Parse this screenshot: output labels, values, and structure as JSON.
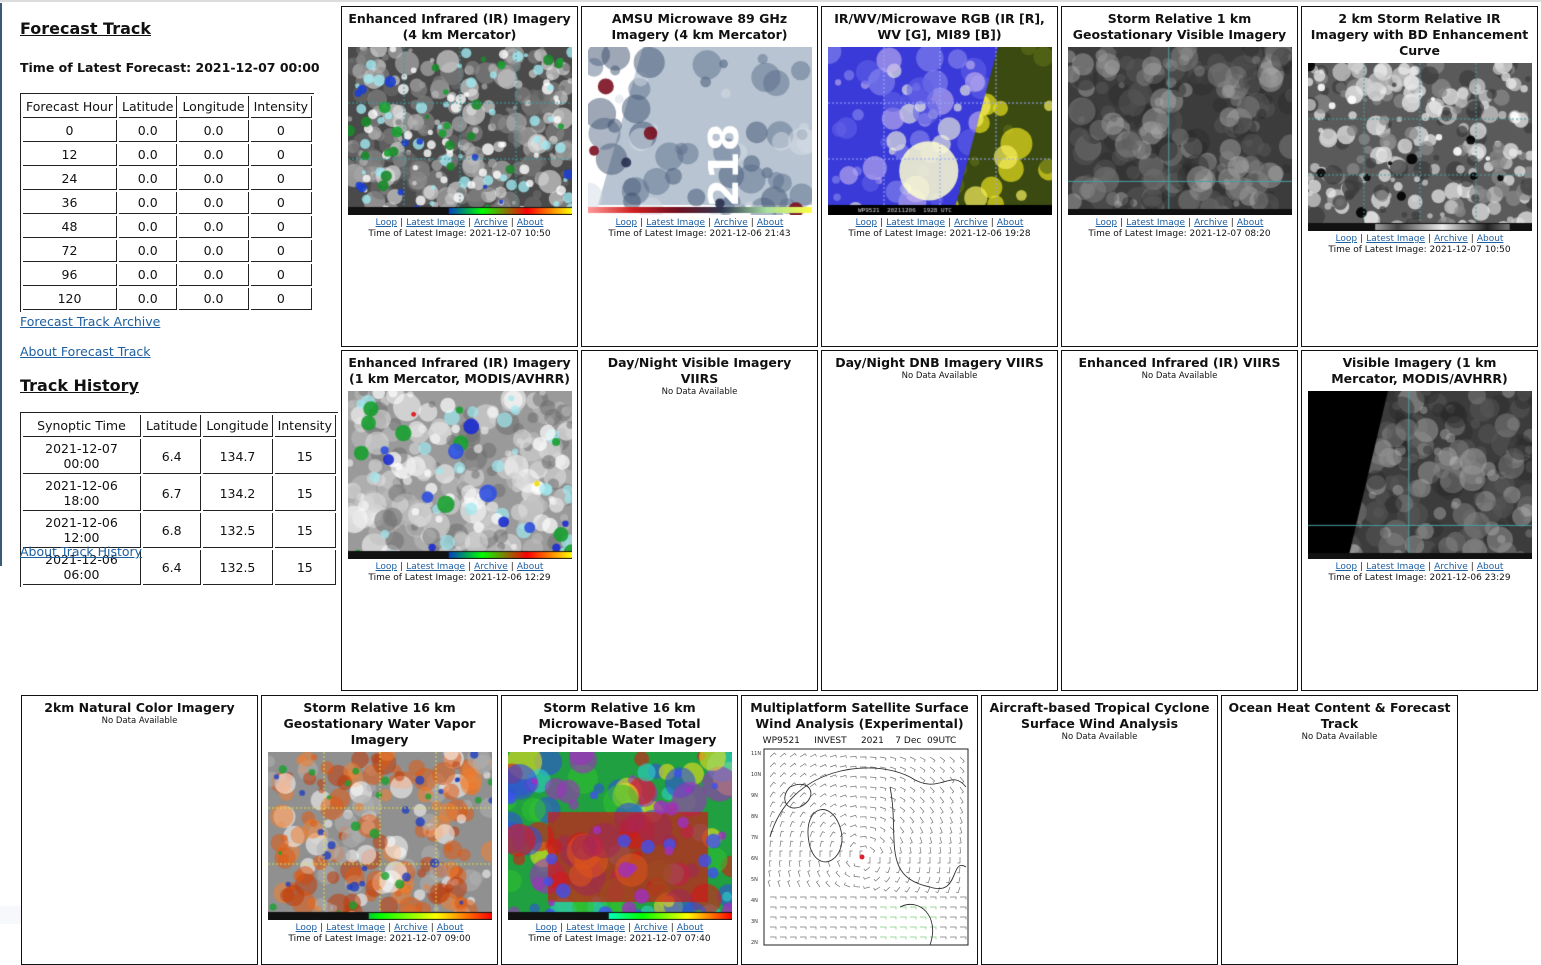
{
  "forecast": {
    "title": "Forecast Track",
    "latest_label": "Time of Latest Forecast: 2021-12-07 00:00",
    "headers": [
      "Forecast Hour",
      "Latitude",
      "Longitude",
      "Intensity"
    ],
    "rows": [
      [
        "0",
        "0.0",
        "0.0",
        "0"
      ],
      [
        "12",
        "0.0",
        "0.0",
        "0"
      ],
      [
        "24",
        "0.0",
        "0.0",
        "0"
      ],
      [
        "36",
        "0.0",
        "0.0",
        "0"
      ],
      [
        "48",
        "0.0",
        "0.0",
        "0"
      ],
      [
        "72",
        "0.0",
        "0.0",
        "0"
      ],
      [
        "96",
        "0.0",
        "0.0",
        "0"
      ],
      [
        "120",
        "0.0",
        "0.0",
        "0"
      ]
    ],
    "archive_link": "Forecast Track Archive",
    "about_link": "About Forecast Track"
  },
  "history": {
    "title": "Track History",
    "headers": [
      "Synoptic Time",
      "Latitude",
      "Longitude",
      "Intensity"
    ],
    "rows": [
      [
        "2021-12-07 00:00",
        "6.4",
        "134.7",
        "15"
      ],
      [
        "2021-12-06 18:00",
        "6.7",
        "134.2",
        "15"
      ],
      [
        "2021-12-06 12:00",
        "6.8",
        "132.5",
        "15"
      ],
      [
        "2021-12-06 06:00",
        "6.4",
        "132.5",
        "15"
      ]
    ],
    "about_link": "About Track History"
  },
  "common": {
    "loop": "Loop",
    "latest": "Latest Image",
    "archive": "Archive",
    "about": "About",
    "sep": "|",
    "no_data": "No Data Available"
  },
  "products": [
    {
      "title": "Enhanced Infrared (IR) Imagery (4 km Mercator)",
      "time": "Time of Latest Image: 2021-12-07 10:50",
      "image": "ir-4km-image"
    },
    {
      "title": "AMSU Microwave 89 GHz Imagery (4 km Mercator)",
      "time": "Time of Latest Image: 2021-12-06 21:43",
      "image": "amsu-89ghz-image"
    },
    {
      "title": "IR/WV/Microwave RGB (IR [R], WV [G], MI89 [B])",
      "time": "Time of Latest Image: 2021-12-06 19:28",
      "image": "rgb-composite-image",
      "overlay": "WP9521  20211206  1928 UTC"
    },
    {
      "title": "Storm Relative 1 km Geostationary Visible Imagery",
      "time": "Time of Latest Image: 2021-12-07 08:20",
      "image": "visible-1km-image"
    },
    {
      "title": "2 km Storm Relative IR Imagery with BD Enhancement Curve",
      "time": "Time of Latest Image: 2021-12-07 10:50",
      "image": "bd-ir-image"
    },
    {
      "title": "Enhanced Infrared (IR) Imagery (1 km Mercator, MODIS/AVHRR)",
      "time": "Time of Latest Image: 2021-12-06 12:29",
      "image": "ir-1km-image"
    },
    {
      "title": "Day/Night Visible Imagery VIIRS"
    },
    {
      "title": "Day/Night DNB Imagery VIIRS"
    },
    {
      "title": "Enhanced Infrared (IR) VIIRS"
    },
    {
      "title": "Visible Imagery (1 km Mercator, MODIS/AVHRR)",
      "time": "Time of Latest Image: 2021-12-06 23:29",
      "image": "visible-modis-image"
    },
    {
      "title": "2km Natural Color Imagery"
    },
    {
      "title": "Storm Relative 16 km Geostationary Water Vapor Imagery",
      "time": "Time of Latest Image: 2021-12-07 09:00",
      "image": "water-vapor-image"
    },
    {
      "title": "Storm Relative 16 km Microwave-Based Total Precipitable Water Imagery",
      "time": "Time of Latest Image: 2021-12-07 07:40",
      "image": "tpw-image"
    },
    {
      "title": "Multiplatform Satellite Surface Wind Analysis (Experimental)",
      "image": "wind-analysis-image",
      "wind_header": "WP9521     INVEST     2021    7 Dec  09UTC",
      "lat_ticks": [
        "11N",
        "10N",
        "9N",
        "8N",
        "7N",
        "6N",
        "5N",
        "4N",
        "3N",
        "2N"
      ]
    },
    {
      "title": "Aircraft-based Tropical Cyclone Surface Wind Analysis"
    },
    {
      "title": "Ocean Heat Content & Forecast Track"
    }
  ]
}
